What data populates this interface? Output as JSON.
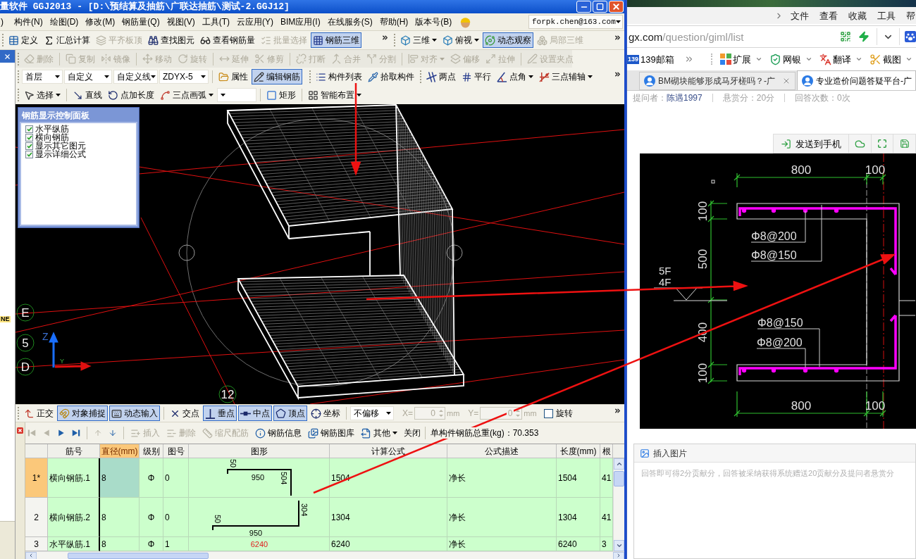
{
  "app": {
    "title": "量软件 GGJ2013 - [D:\\预结算及抽筋\\广联达抽筋\\测试-2.GGJ12]",
    "menu": [
      ")",
      "构件(N)",
      "绘图(D)",
      "修改(M)",
      "钢筋量(Q)",
      "视图(V)",
      "工具(T)",
      "云应用(Y)",
      "BIM应用(I)",
      "在线服务(S)",
      "帮助(H)",
      "版本号(B)"
    ],
    "account": "forpk.chen@163.com",
    "toolbars": [
      {
        "bands": [
          {
            "overflow": true,
            "groups": [
              [
                {
                  "kind": "button",
                  "label": "定义",
                  "disabled": false,
                  "pressed": false
                },
                {
                  "kind": "button",
                  "label": "汇总计算",
                  "disabled": false,
                  "pressed": false
                },
                {
                  "kind": "button",
                  "label": "平齐板顶",
                  "disabled": true,
                  "pressed": false
                },
                {
                  "kind": "button",
                  "label": "查找图元",
                  "disabled": false,
                  "pressed": false
                },
                {
                  "kind": "button",
                  "label": "查看钢筋量",
                  "disabled": false,
                  "pressed": false
                },
                {
                  "kind": "button",
                  "label": "批量选择",
                  "disabled": true,
                  "pressed": false
                },
                {
                  "kind": "button",
                  "label": "钢筋三维",
                  "disabled": false,
                  "pressed": true
                }
              ]
            ]
          },
          {
            "overflow": true,
            "groups": [
              [
                {
                  "kind": "menu",
                  "label": "三维",
                  "disabled": false,
                  "pressed": false
                },
                {
                  "kind": "menu",
                  "label": "俯视",
                  "disabled": false,
                  "pressed": false
                },
                {
                  "kind": "button",
                  "label": "动态观察",
                  "disabled": false,
                  "pressed": true
                },
                {
                  "kind": "button",
                  "label": "局部三维",
                  "disabled": true,
                  "pressed": false
                }
              ]
            ]
          }
        ]
      },
      {
        "bands": [
          {
            "groups": [
              [
                {
                  "kind": "button",
                  "label": "删除",
                  "disabled": true,
                  "pressed": false
                }
              ],
              [
                {
                  "kind": "button",
                  "label": "复制",
                  "disabled": true,
                  "pressed": false
                },
                {
                  "kind": "button",
                  "label": "镜像",
                  "disabled": true,
                  "pressed": false
                }
              ],
              [
                {
                  "kind": "button",
                  "label": "移动",
                  "disabled": true,
                  "pressed": false
                },
                {
                  "kind": "button",
                  "label": "旋转",
                  "disabled": true,
                  "pressed": false
                }
              ],
              [
                {
                  "kind": "button",
                  "label": "延伸",
                  "disabled": true,
                  "pressed": false
                },
                {
                  "kind": "button",
                  "label": "修剪",
                  "disabled": true,
                  "pressed": false
                }
              ],
              [
                {
                  "kind": "button",
                  "label": "打断",
                  "disabled": true,
                  "pressed": false
                },
                {
                  "kind": "button",
                  "label": "合并",
                  "disabled": true,
                  "pressed": false
                },
                {
                  "kind": "button",
                  "label": "分割",
                  "disabled": true,
                  "pressed": false
                }
              ],
              [
                {
                  "kind": "menu",
                  "label": "对齐",
                  "disabled": true,
                  "pressed": false
                },
                {
                  "kind": "button",
                  "label": "偏移",
                  "disabled": true,
                  "pressed": false
                },
                {
                  "kind": "button",
                  "label": "拉伸",
                  "disabled": true,
                  "pressed": false
                }
              ],
              [
                {
                  "kind": "button",
                  "label": "设置夹点",
                  "disabled": true,
                  "pressed": false
                }
              ]
            ]
          }
        ]
      },
      {
        "bands": [
          {
            "groups": [
              [
                {
                  "kind": "combo",
                  "value": "首层",
                  "disabled": false,
                  "pressed": false
                },
                {
                  "kind": "combo",
                  "value": "自定义",
                  "disabled": false,
                  "pressed": false
                },
                {
                  "kind": "combo",
                  "value": "自定义线",
                  "disabled": false,
                  "pressed": false
                },
                {
                  "kind": "combo",
                  "value": "ZDYX-5",
                  "disabled": false,
                  "pressed": false
                }
              ],
              [
                {
                  "kind": "button",
                  "label": "属性",
                  "disabled": false,
                  "pressed": false
                },
                {
                  "kind": "button",
                  "label": "编辑钢筋",
                  "disabled": false,
                  "pressed": true
                }
              ]
            ]
          },
          {
            "groups": [
              [
                {
                  "kind": "button",
                  "label": "构件列表",
                  "disabled": false,
                  "pressed": false
                },
                {
                  "kind": "button",
                  "label": "拾取构件",
                  "disabled": false,
                  "pressed": false
                }
              ]
            ]
          },
          {
            "overflow": true,
            "groups": [
              [
                {
                  "kind": "button",
                  "label": "两点",
                  "disabled": false,
                  "pressed": false
                },
                {
                  "kind": "button",
                  "label": "平行",
                  "disabled": false,
                  "pressed": false
                },
                {
                  "kind": "menu",
                  "label": "点角",
                  "disabled": false,
                  "pressed": false
                },
                {
                  "kind": "menu",
                  "label": "三点辅轴",
                  "disabled": false,
                  "pressed": false
                }
              ]
            ]
          }
        ]
      },
      {
        "bands": [
          {
            "groups": [
              [
                {
                  "kind": "menu",
                  "label": "选择",
                  "disabled": false,
                  "pressed": false
                }
              ],
              [
                {
                  "kind": "button",
                  "label": "直线",
                  "disabled": false,
                  "pressed": false
                },
                {
                  "kind": "button",
                  "label": "点加长度",
                  "disabled": false,
                  "pressed": false
                },
                {
                  "kind": "menu",
                  "label": "三点画弧",
                  "disabled": false,
                  "pressed": false
                },
                {
                  "kind": "combo",
                  "disabled": false,
                  "pressed": false
                }
              ],
              [
                {
                  "kind": "button",
                  "label": "矩形",
                  "disabled": false,
                  "pressed": false
                }
              ],
              [
                {
                  "kind": "menu",
                  "label": "智能布置",
                  "disabled": false,
                  "pressed": false
                }
              ]
            ]
          }
        ]
      }
    ],
    "dock_panel": {
      "tag": "NE"
    },
    "view3d": {
      "panel": {
        "title": "钢筋显示控制面板",
        "options": [
          {
            "label": "水平纵筋",
            "checked": true
          },
          {
            "label": "横向钢筋",
            "checked": true
          },
          {
            "label": "显示其它图元",
            "checked": true
          },
          {
            "label": "显示详细公式",
            "checked": true
          }
        ]
      },
      "axis_labels": [
        "E",
        "5",
        "D",
        "12"
      ],
      "axis_letters": [
        "Z",
        "Y"
      ]
    },
    "snap_bar": {
      "overflow": true,
      "groups": [
        [
          {
            "kind": "button",
            "label": "正交",
            "disabled": false,
            "pressed": false
          },
          {
            "kind": "button",
            "label": "对象捕捉",
            "disabled": false,
            "pressed": true
          },
          {
            "kind": "button",
            "label": "动态输入",
            "disabled": false,
            "pressed": true
          }
        ],
        [
          {
            "kind": "button",
            "label": "交点",
            "disabled": false,
            "pressed": false
          },
          {
            "kind": "button",
            "label": "垂点",
            "disabled": false,
            "pressed": true
          },
          {
            "kind": "button",
            "label": "中点",
            "disabled": false,
            "pressed": true
          },
          {
            "kind": "button",
            "label": "顶点",
            "disabled": false,
            "pressed": true
          },
          {
            "kind": "button",
            "label": "坐标",
            "disabled": false,
            "pressed": false
          }
        ],
        [
          {
            "kind": "combo",
            "value": "不偏移",
            "disabled": false,
            "pressed": false
          },
          {
            "kind": "field",
            "label": "X=",
            "value": "0",
            "unit": "mm",
            "disabled": true
          },
          {
            "kind": "field",
            "label": "Y=",
            "value": "0",
            "unit": "mm",
            "disabled": true
          },
          {
            "kind": "checkbox",
            "label": "旋转",
            "checked": false,
            "disabled": false
          }
        ]
      ]
    },
    "table_toolbar": {
      "groups": [
        [
          {
            "kind": "nav",
            "disabled": true,
            "pressed": false
          },
          {
            "kind": "nav",
            "disabled": true,
            "pressed": false
          },
          {
            "kind": "nav",
            "disabled": false,
            "pressed": false
          },
          {
            "kind": "nav",
            "disabled": false,
            "pressed": false
          }
        ],
        [
          {
            "kind": "nav",
            "disabled": true,
            "pressed": false
          },
          {
            "kind": "nav",
            "disabled": false,
            "pressed": false
          }
        ],
        [
          {
            "kind": "button",
            "label": "插入",
            "disabled": true,
            "pressed": false
          },
          {
            "kind": "button",
            "label": "删除",
            "disabled": true,
            "pressed": false
          },
          {
            "kind": "button",
            "label": "缩尺配筋",
            "disabled": true,
            "pressed": false
          },
          {
            "kind": "button",
            "label": "钢筋信息",
            "disabled": false,
            "pressed": false
          },
          {
            "kind": "button",
            "label": "钢筋图库",
            "disabled": false,
            "pressed": false
          },
          {
            "kind": "menu",
            "label": "其他",
            "disabled": false,
            "pressed": false
          },
          {
            "kind": "button",
            "label": "关闭",
            "disabled": false,
            "pressed": false
          }
        ]
      ],
      "summary": "单构件钢筋总重(kg)：70.353"
    },
    "table": {
      "columns": [
        {
          "label": "筋号",
          "selected": false
        },
        {
          "label": "直径(mm)",
          "selected": true
        },
        {
          "label": "级别",
          "selected": false
        },
        {
          "label": "图号",
          "selected": false
        },
        {
          "label": "图形",
          "selected": false
        },
        {
          "label": "计算公式",
          "selected": false
        },
        {
          "label": "公式描述",
          "selected": false
        },
        {
          "label": "长度(mm)",
          "selected": false
        },
        {
          "label": "根",
          "selected": false
        }
      ],
      "rows": [
        {
          "row_header": "1*",
          "selected": true,
          "bar_no": "横向钢筋.1",
          "diameter": "8",
          "grade": "Φ",
          "figure_no": "0",
          "shape": {
            "kind": "hook_top_drop",
            "labels": [
              "50",
              "950",
              "504"
            ]
          },
          "formula": "1504",
          "description": "净长",
          "length": "1504",
          "count": "41"
        },
        {
          "row_header": "2",
          "selected": false,
          "bar_no": "横向钢筋.2",
          "diameter": "8",
          "grade": "Φ",
          "figure_no": "0",
          "shape": {
            "kind": "rise_hook_bottom",
            "labels": [
              "304",
              "50",
              "950"
            ]
          },
          "formula": "1304",
          "description": "净长",
          "length": "1304",
          "count": "41"
        },
        {
          "row_header": "3",
          "selected": false,
          "bar_no": "水平纵筋.1",
          "diameter": "8",
          "grade": "Φ",
          "figure_no": "1",
          "shape": {
            "kind": "straight",
            "labels": [
              "6240"
            ]
          },
          "formula": "6240",
          "description": "净长",
          "length": "6240",
          "count": "3"
        }
      ]
    }
  },
  "browser": {
    "menu": [
      "文件",
      "查看",
      "收藏",
      "工具",
      "帮"
    ],
    "address": {
      "domain": "gx.com",
      "path": "/question/giml/list"
    },
    "bookmarks": [
      {
        "badge": "139",
        "label": "139邮箱"
      }
    ],
    "tools": [
      {
        "label": "扩展"
      },
      {
        "label": "网银"
      },
      {
        "label": "翻译"
      },
      {
        "label": "截图"
      }
    ],
    "tabs": [
      {
        "title": "BM砌块能够形成马牙槎吗？-广",
        "selected": false
      },
      {
        "title": "专业造价问题答疑平台-广",
        "selected": true
      }
    ],
    "question": {
      "asker_label": "提问者：",
      "asker": "陈遇1997",
      "bounty": "悬赏分：20分",
      "answers": "回答次数：0次"
    },
    "image_actions": {
      "send": "发送到手机"
    },
    "cad": {
      "top_dims": [
        "800",
        "100"
      ],
      "left_dims": [
        "100",
        "500",
        "400",
        "100"
      ],
      "levels": [
        "5F",
        "4F"
      ],
      "top_specs": [
        "Φ8@200",
        "Φ8@150"
      ],
      "bottom_specs": [
        "Φ8@150",
        "Φ8@200"
      ],
      "bottom_dims": [
        "800",
        "100"
      ]
    },
    "answer": {
      "title": "插入图片",
      "placeholder": "回答即可得2分贡献分，回答被采纳获得系统赠送20贡献分及提问者悬赏分"
    }
  }
}
